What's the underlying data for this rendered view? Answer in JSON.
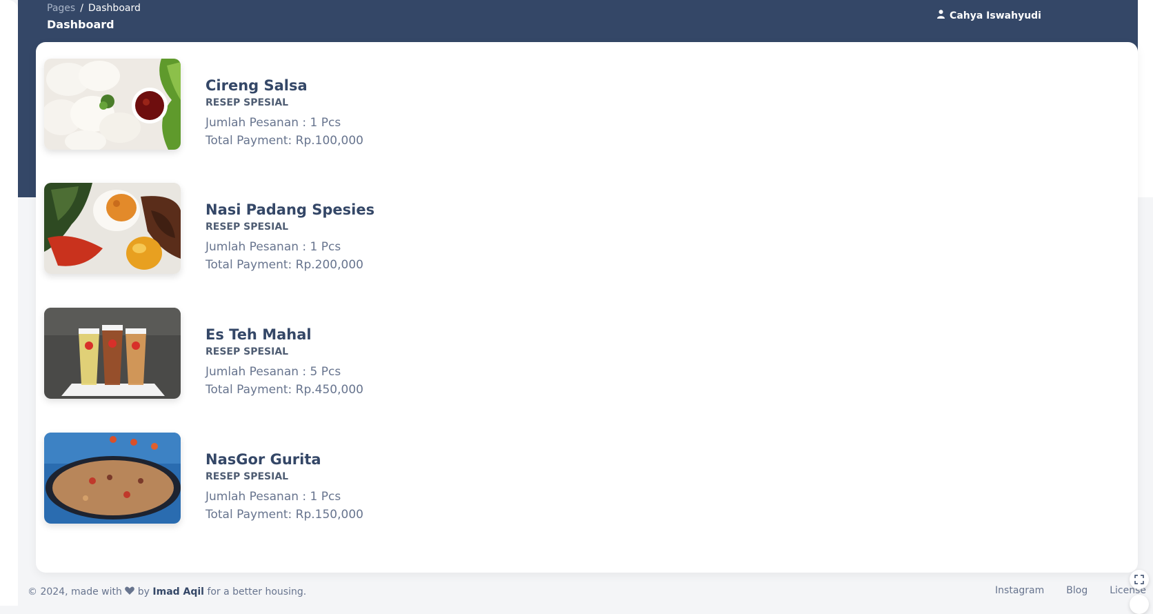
{
  "breadcrumb": {
    "parent": "Pages",
    "separator": "/",
    "current": "Dashboard"
  },
  "page_title": "Dashboard",
  "user": {
    "name": "Cahya Iswahyudi",
    "icon": "user-icon"
  },
  "orders": [
    {
      "name": "Cireng Salsa",
      "tag": "RESEP SPESIAL",
      "qty": "Jumlah Pesanan : 1 Pcs",
      "total": "Total Payment: Rp.100,000",
      "image": "cireng-salsa-image"
    },
    {
      "name": "Nasi Padang Spesies",
      "tag": "RESEP SPESIAL",
      "qty": "Jumlah Pesanan : 1 Pcs",
      "total": "Total Payment: Rp.200,000",
      "image": "nasi-padang-image"
    },
    {
      "name": "Es Teh Mahal",
      "tag": "RESEP SPESIAL",
      "qty": "Jumlah Pesanan : 5 Pcs",
      "total": "Total Payment: Rp.450,000",
      "image": "es-teh-image"
    },
    {
      "name": "NasGor Gurita",
      "tag": "RESEP SPESIAL",
      "qty": "Jumlah Pesanan : 1 Pcs",
      "total": "Total Payment: Rp.150,000",
      "image": "nasgor-gurita-image"
    }
  ],
  "footer": {
    "prefix": "© 2024, made with",
    "by": "by",
    "author": "Imad Aqil",
    "suffix": "for a better housing.",
    "links": [
      "Instagram",
      "Blog",
      "License"
    ]
  },
  "colors": {
    "header": "#344767",
    "text_dark": "#344767",
    "text_muted": "#67748e",
    "background": "#f4f5f7"
  }
}
